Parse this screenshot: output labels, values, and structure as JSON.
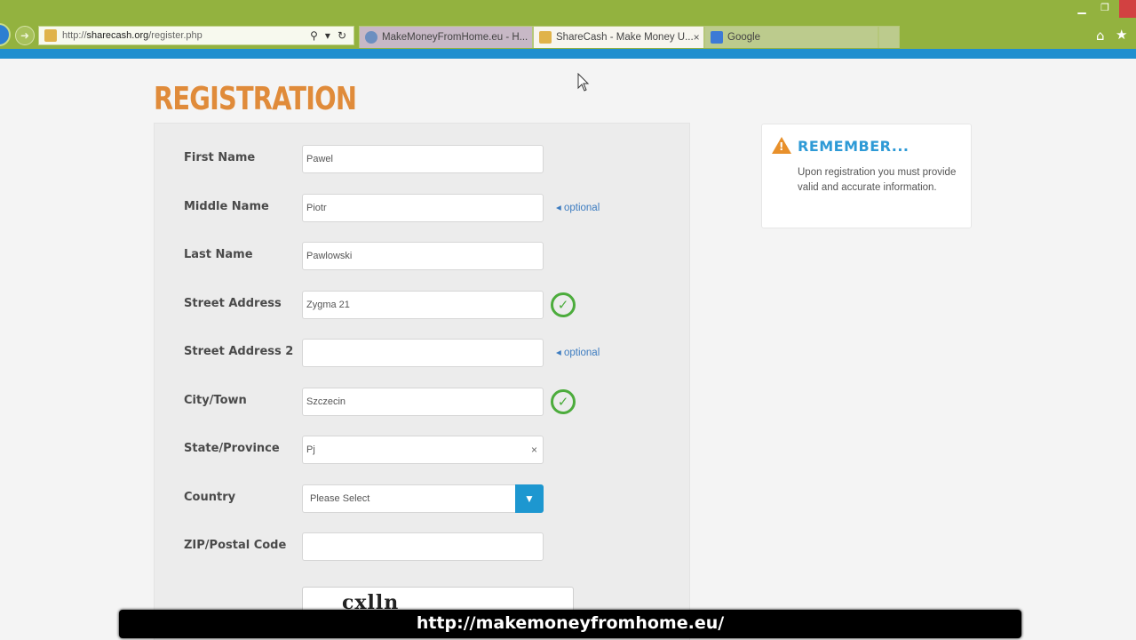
{
  "browser": {
    "url_prefix": "http://",
    "url_host": "sharecash.org",
    "url_path": "/register.php",
    "tabs": [
      {
        "label": "MakeMoneyFromHome.eu - H..."
      },
      {
        "label": "ShareCash - Make Money U...",
        "close": "×"
      },
      {
        "label": "Google"
      }
    ]
  },
  "page": {
    "title": "REGISTRATION"
  },
  "form": {
    "fields": [
      {
        "label": "First Name",
        "value": "Pawel"
      },
      {
        "label": "Middle Name",
        "value": "Piotr",
        "note": "◂ optional"
      },
      {
        "label": "Last Name",
        "value": "Pawlowski"
      },
      {
        "label": "Street Address",
        "value": "Zygma 21"
      },
      {
        "label": "Street Address 2",
        "value": "",
        "note": "◂ optional"
      },
      {
        "label": "City/Town",
        "value": "Szczecin"
      },
      {
        "label": "State/Province",
        "value": "Pj",
        "clear": "×"
      },
      {
        "label": "Country",
        "value": "Please Select"
      },
      {
        "label": "ZIP/Postal Code",
        "value": ""
      }
    ],
    "captcha_text": "cxlln"
  },
  "remember": {
    "title": "REMEMBER...",
    "text": "Upon registration you must provide valid and accurate information."
  },
  "caption": {
    "text": "http://makemoneyfromhome.eu/"
  },
  "colors": {
    "chrome_green": "#93b23f",
    "chrome_blue": "#1f8fcf",
    "title_orange": "#e08b3a",
    "accent_blue": "#2e9ad6",
    "valid_green": "#4cac3c"
  }
}
